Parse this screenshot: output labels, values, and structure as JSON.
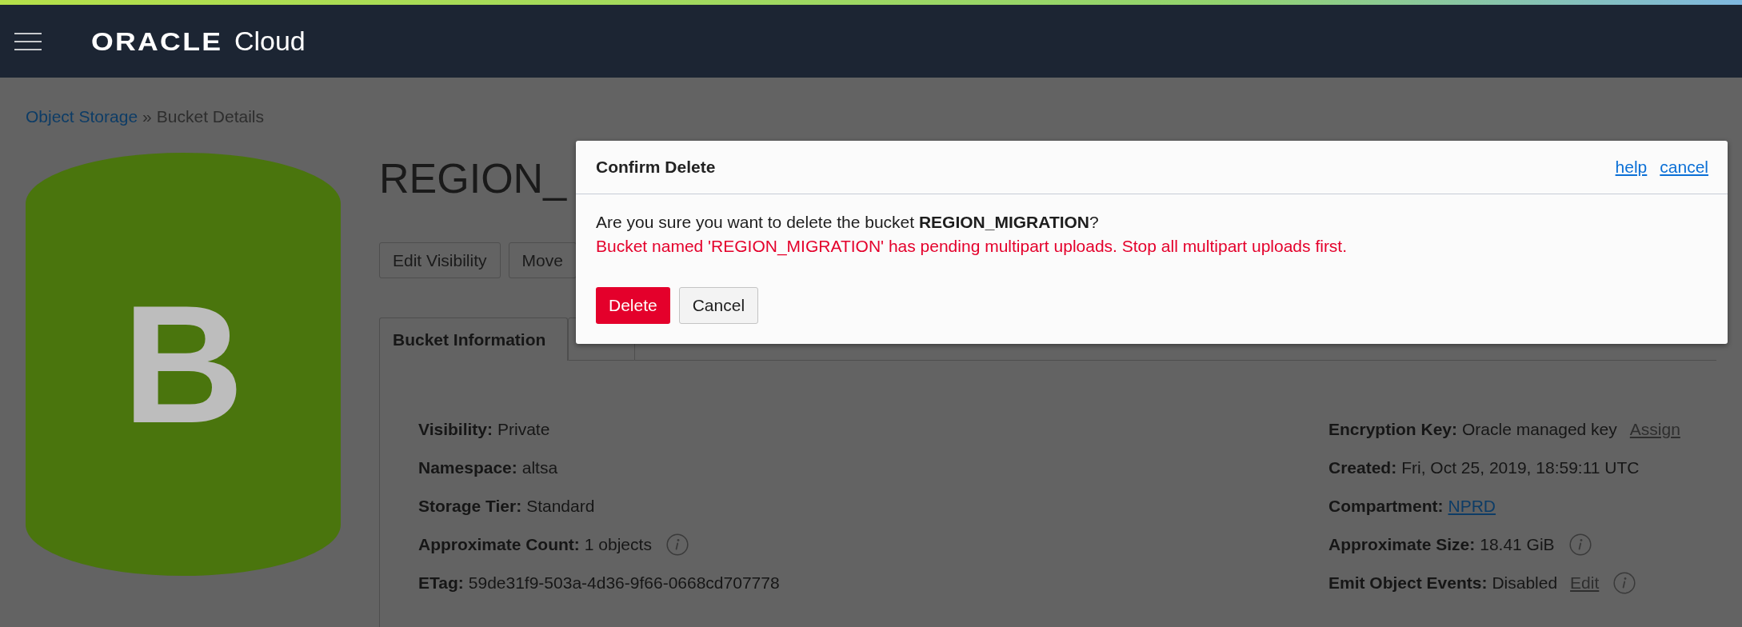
{
  "header": {
    "logo_brand": "ORACLE",
    "logo_product": "Cloud"
  },
  "breadcrumb": {
    "items": [
      {
        "label": "Object Storage",
        "kind": "link"
      },
      {
        "label": "Bucket Details",
        "kind": "current"
      }
    ],
    "separator": "»"
  },
  "bucket": {
    "icon_letter": "B",
    "title": "REGION_",
    "actions": [
      "Edit Visibility",
      "Move"
    ],
    "tabs": [
      {
        "label": "Bucket Information",
        "selected": true
      },
      {
        "selected": false
      }
    ],
    "info_left": [
      {
        "label": "Visibility:",
        "value": "Private",
        "info": false
      },
      {
        "label": "Namespace:",
        "value": "altsa",
        "info": false
      },
      {
        "label": "Storage Tier:",
        "value": "Standard",
        "info": false
      },
      {
        "label": "Approximate Count:",
        "value": "1 objects",
        "info": true
      },
      {
        "label": "ETag:",
        "value": "59de31f9-503a-4d36-9f66-0668cd707778",
        "info": false
      }
    ],
    "info_right": [
      {
        "kind": "text",
        "label": "Encryption Key:",
        "value": "Oracle managed key",
        "action": "Assign",
        "info": false
      },
      {
        "kind": "text",
        "label": "Created:",
        "value": "Fri, Oct 25, 2019, 18:59:11 UTC",
        "info": false
      },
      {
        "kind": "link",
        "label": "Compartment:",
        "value": "NPRD",
        "info": false
      },
      {
        "kind": "text",
        "label": "Approximate Size:",
        "value": "18.41 GiB",
        "info": true
      },
      {
        "kind": "text",
        "label": "Emit Object Events:",
        "value": "Disabled",
        "action": "Edit",
        "info": true
      }
    ]
  },
  "dialog": {
    "title": "Confirm Delete",
    "links": [
      "help",
      "cancel"
    ],
    "message": "Are you sure you want to delete the bucket **REGION_MIGRATION**?",
    "error": "Bucket named 'REGION_MIGRATION' has pending multipart uploads. Stop all multipart uploads first.",
    "buttons": [
      {
        "label": "Delete",
        "kind": "primary"
      },
      {
        "label": "Cancel",
        "kind": "secondary"
      }
    ]
  }
}
